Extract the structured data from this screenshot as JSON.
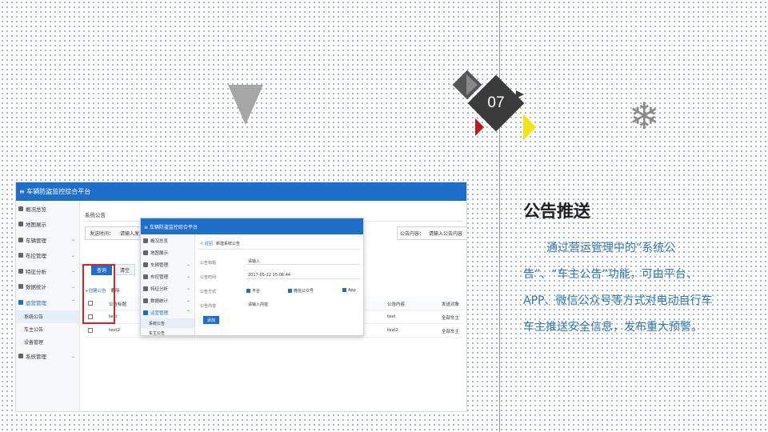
{
  "slide": {
    "number": "07",
    "title": "公告推送",
    "paragraph": "通过营运管理中的“系统公告”、“车主公告”功能，可由平台、APP、微信公众号等方式对电动自行车车主推送安全信息，发布重大预警。",
    "snowflake_icon": "❄"
  },
  "screenshot": {
    "app_title": "≡ 车辆防盗监控综合平台",
    "sidebar": [
      {
        "label": "概况总览",
        "icon": "grid-icon"
      },
      {
        "label": "地图展示",
        "icon": "map-icon"
      },
      {
        "label": "车辆管理",
        "icon": "bike-icon"
      },
      {
        "label": "布控管理",
        "icon": "gear-icon"
      },
      {
        "label": "特征分析",
        "icon": "chart-icon"
      },
      {
        "label": "数据统计",
        "icon": "stats-icon"
      },
      {
        "label": "运营管理",
        "icon": "ops-icon"
      }
    ],
    "sidebar_sub": [
      "系统公告",
      "车主公告",
      "设备管理"
    ],
    "sidebar_last": "系统管理",
    "page_title": "系统公告",
    "search_time_label": "发送时间：",
    "search_time_placeholder": "请输入发送",
    "search_content_label": "公告内容：",
    "search_content_placeholder": "请输入公告内容",
    "query_button": "查询",
    "clear_button": "清空",
    "new_button": "+创建公告",
    "delete_button": "删除",
    "table_headers": [
      "公告标题",
      "公告内容",
      "发送对象"
    ],
    "rows": [
      {
        "title": "test",
        "content": "test",
        "target": "全部车主"
      },
      {
        "title": "test2",
        "content": "test2",
        "target": "全部车主"
      }
    ],
    "dialog": {
      "app_title": "≡ 车辆防盗监控综合平台",
      "back": "< 返回",
      "title": "新建系统公告",
      "field_title_label": "公告标题",
      "field_title_value": "请输入",
      "field_time_label": "公告时间",
      "field_time_value": "2017-05-22 15:06:44",
      "field_method_label": "公告方式",
      "method_platform": "平台",
      "method_wechat": "微信公众号",
      "method_app": "App",
      "field_content_label": "公告内容",
      "field_content_value": "请输入内容",
      "submit": "添加"
    }
  }
}
